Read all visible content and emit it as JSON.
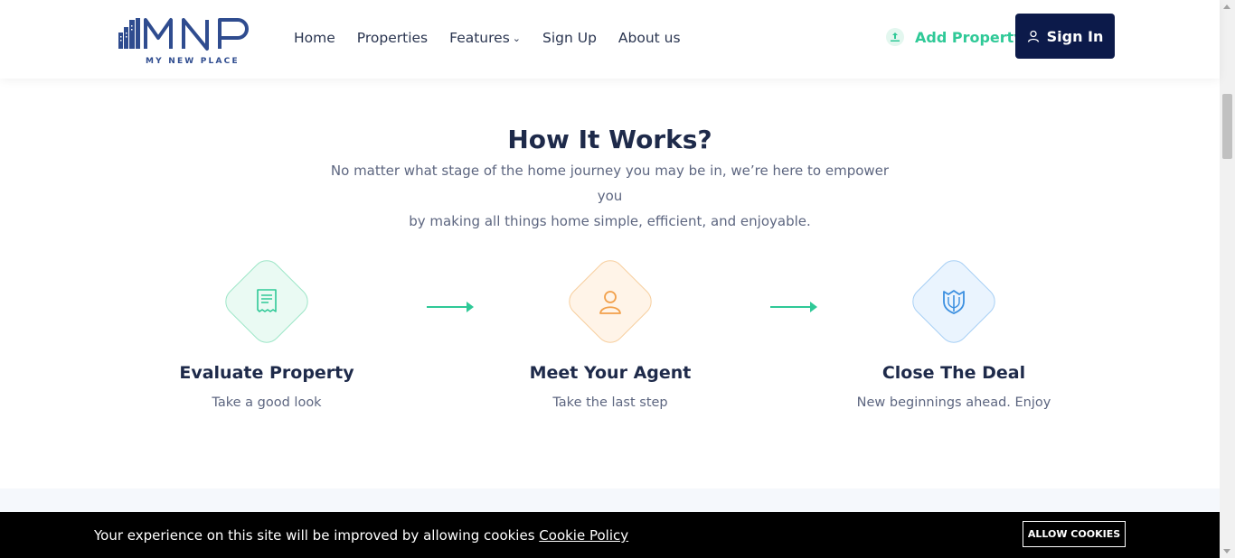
{
  "brand": {
    "logo_text": "MNP",
    "tagline": "MY NEW PLACE"
  },
  "nav": {
    "items": [
      {
        "label": "Home"
      },
      {
        "label": "Properties"
      },
      {
        "label": "Features"
      },
      {
        "label": "Sign Up"
      },
      {
        "label": "About us"
      }
    ]
  },
  "header_actions": {
    "add_property": "Add Property",
    "sign_in": "Sign In"
  },
  "section": {
    "title": "How It Works?",
    "subtitle_line1": "No matter what stage of the home journey you may be in, we’re here to empower you",
    "subtitle_line2": "by making all things home simple, efficient, and enjoyable."
  },
  "steps": [
    {
      "title": "Evaluate Property",
      "desc": "Take a good look",
      "icon": "receipt-icon",
      "color": "#2fc997"
    },
    {
      "title": "Meet Your Agent",
      "desc": "Take the last step",
      "icon": "user-icon",
      "color": "#f2a04a"
    },
    {
      "title": "Close The Deal",
      "desc": "New beginnings ahead. Enjoy",
      "icon": "shield-icon",
      "color": "#3b8fe0"
    }
  ],
  "cookie": {
    "message": "Your experience on this site will be improved by allowing cookies",
    "link": "Cookie Policy",
    "button": "ALLOW COOKIES"
  },
  "colors": {
    "accent_green": "#2fc997",
    "navy": "#0c1a4a"
  }
}
